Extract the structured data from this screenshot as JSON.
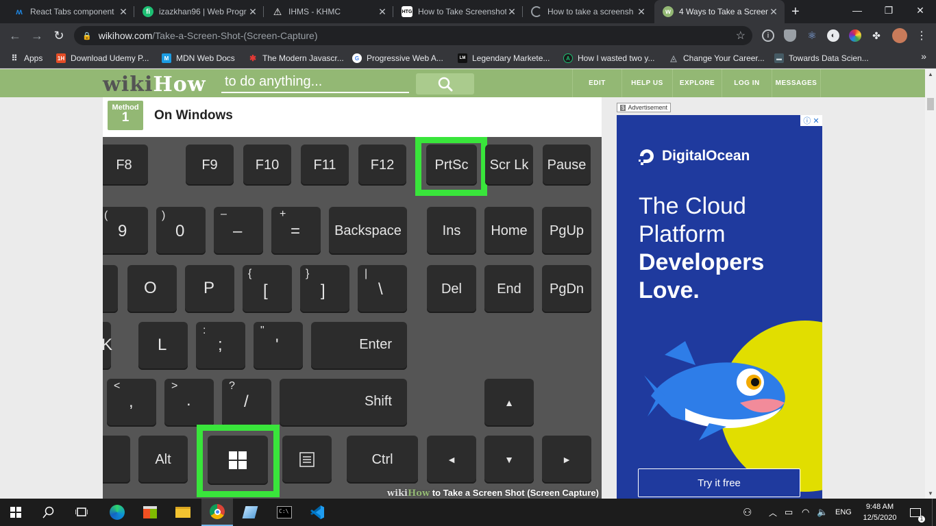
{
  "browser": {
    "tabs": [
      {
        "title": "React Tabs component",
        "icon": "mui-icon",
        "color": "#1e88e5"
      },
      {
        "title": "izazkhan96 | Web Progr",
        "icon": "fiverr-icon",
        "color": "#1dbf73"
      },
      {
        "title": "IHMS - KHMC",
        "icon": "warning-triangle-icon",
        "color": "#ffffff"
      },
      {
        "title": "How to Take Screenshot",
        "icon": "htg-icon",
        "color": "#ffffff"
      },
      {
        "title": "How to take a screensh",
        "icon": "loading-icon",
        "color": "#9aa0a6"
      },
      {
        "title": "4 Ways to Take a Screen",
        "icon": "wikihow-icon",
        "color": "#93b874",
        "active": true
      }
    ],
    "address": {
      "host": "wikihow.com",
      "path": "/Take-a-Screen-Shot-(Screen-Capture)"
    },
    "bookmarks": [
      {
        "label": "Apps",
        "icon": "apps-grid-icon",
        "color": "#e8eaed"
      },
      {
        "label": "Download Udemy P...",
        "icon": "1h-icon",
        "color": "#e44d26",
        "glyph": "1H"
      },
      {
        "label": "MDN Web Docs",
        "icon": "mdn-icon",
        "color": "#1b9ce2",
        "glyph": "M"
      },
      {
        "label": "The Modern Javascr...",
        "icon": "javascript-info-icon",
        "color": "#e53935",
        "glyph": "✱"
      },
      {
        "label": "Progressive Web A...",
        "icon": "google-icon",
        "color": "#ffffff",
        "glyph": "G"
      },
      {
        "label": "Legendary Markete...",
        "icon": "lm-icon",
        "color": "#111111",
        "glyph": "LM"
      },
      {
        "label": "How I wasted two y...",
        "icon": "medium-icon",
        "color": "#1a1a1a",
        "glyph": "A"
      },
      {
        "label": "Change Your Career...",
        "icon": "sitepoint-icon",
        "color": "#5f6368",
        "glyph": "◬"
      },
      {
        "label": "Towards Data Scien...",
        "icon": "tds-icon",
        "color": "#455a64",
        "glyph": "▬"
      }
    ]
  },
  "wikihow": {
    "logo_part1": "wiki",
    "logo_part2": "How",
    "search_placeholder": "to do anything...",
    "nav": [
      "EDIT",
      "HELP US",
      "EXPLORE",
      "LOG IN",
      "MESSAGES"
    ],
    "method_label": "Method",
    "method_number": "1",
    "method_title": "On Windows",
    "image_caption_logo1": "wiki",
    "image_caption_logo2": "How",
    "image_caption": " to Take a Screen Shot (Screen Capture)"
  },
  "keyboard": {
    "function_row": [
      "F8",
      "F9",
      "F10",
      "F11",
      "F12",
      "PrtSc",
      "Scr Lk",
      "Pause"
    ],
    "number_row": [
      {
        "main": "9",
        "shift": "("
      },
      {
        "main": "0",
        "shift": ")"
      },
      {
        "main": "–",
        "shift": "–"
      },
      {
        "main": "=",
        "shift": "+"
      },
      {
        "main": "Backspace"
      }
    ],
    "nav_row1": [
      "Ins",
      "Home",
      "PgUp"
    ],
    "letter_row1": [
      {
        "main": "O"
      },
      {
        "main": "P"
      },
      {
        "main": "[",
        "shift": "{"
      },
      {
        "main": "]",
        "shift": "}"
      },
      {
        "main": "\\",
        "shift": "|"
      }
    ],
    "nav_row2": [
      "Del",
      "End",
      "PgDn"
    ],
    "letter_row2": [
      {
        "main": "K"
      },
      {
        "main": "L"
      },
      {
        "main": ";",
        "shift": ":"
      },
      {
        "main": "'",
        "shift": "\""
      },
      {
        "main": "Enter"
      }
    ],
    "letter_row3": [
      {
        "main": ",",
        "shift": "<"
      },
      {
        "main": ".",
        "shift": ">"
      },
      {
        "main": "/",
        "shift": "?"
      },
      {
        "main": "Shift"
      }
    ],
    "arrow_up": "▲",
    "bottom_row": [
      "Alt",
      "Ctrl"
    ],
    "arrows": [
      "◄",
      "▼",
      "►"
    ],
    "highlight_color": "#39e53b"
  },
  "ad": {
    "label": "Advertisement",
    "brand": "DigitalOcean",
    "headline_line1": "The Cloud",
    "headline_line2": "Platform",
    "headline_line3": "Developers",
    "headline_line4": "Love.",
    "cta": "Try it free",
    "bg_color": "#1f3a9e"
  },
  "taskbar": {
    "time": "9:48 AM",
    "date": "12/5/2020",
    "language": "ENG",
    "notification_count": "1"
  }
}
